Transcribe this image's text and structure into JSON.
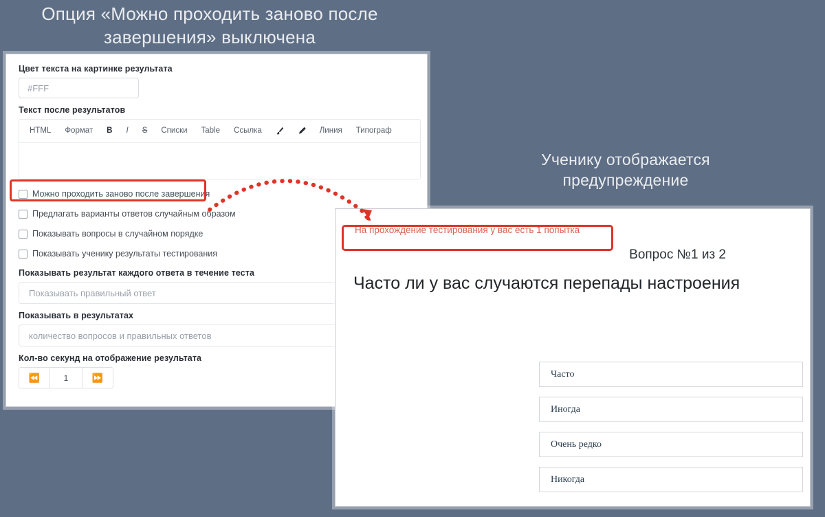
{
  "captions": {
    "left": "Опция «Можно проходить заново после завершения» выключена",
    "right": "Ученику отображается предупреждение"
  },
  "settings_panel": {
    "color_field": {
      "label": "Цвет текста на картинке результата",
      "value": "#FFF"
    },
    "after_results_text": {
      "label": "Текст после результатов",
      "toolbar": [
        {
          "name": "html",
          "label": "HTML"
        },
        {
          "name": "format",
          "label": "Формат"
        },
        {
          "name": "bold",
          "label": "B"
        },
        {
          "name": "italic",
          "label": "I"
        },
        {
          "name": "strikethrough",
          "label": "S"
        },
        {
          "name": "lists",
          "label": "Списки"
        },
        {
          "name": "table",
          "label": "Table"
        },
        {
          "name": "link",
          "label": "Ссылка"
        },
        {
          "name": "brush-icon",
          "label": ""
        },
        {
          "name": "pencil-icon",
          "label": ""
        },
        {
          "name": "line",
          "label": "Линия"
        },
        {
          "name": "typograph",
          "label": "Типограф"
        }
      ],
      "content": ""
    },
    "checkboxes": [
      {
        "label": "Можно проходить заново после завершения",
        "checked": false,
        "highlighted": true
      },
      {
        "label": "Предлагать варианты ответов случайным образом",
        "checked": false,
        "highlighted": false
      },
      {
        "label": "Показывать вопросы в случайном порядке",
        "checked": false,
        "highlighted": false
      },
      {
        "label": "Показывать ученику результаты тестирования",
        "checked": false,
        "highlighted": false
      }
    ],
    "answer_result_select": {
      "label": "Показывать результат каждого ответа в течение теста",
      "value": "Показывать правильный ответ"
    },
    "show_in_results_select": {
      "label": "Показывать в результатах",
      "value": "количество вопросов и правильных ответов"
    },
    "seconds_stepper": {
      "label": "Кол-во секунд на отображение результата",
      "value": "1",
      "prev_icon": "rewind-icon",
      "next_icon": "fast-forward-icon"
    }
  },
  "preview_panel": {
    "attempt_warning": "На прохождение тестирования у вас есть 1 попытка",
    "question_counter": "Вопрос №1 из 2",
    "question_title": "Часто ли у вас случаются перепады настроения",
    "answers": [
      "Часто",
      "Иногда",
      "Очень редко",
      "Никогда"
    ]
  },
  "colors": {
    "background": "#5e6e85",
    "highlight": "#e03428",
    "warning_text": "#d9604f",
    "arrow": "#e03428"
  }
}
